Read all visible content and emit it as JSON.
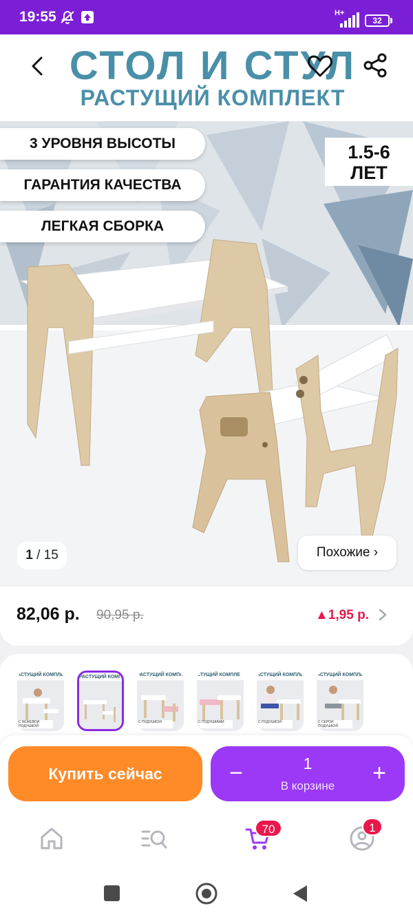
{
  "status_bar": {
    "time": "19:55",
    "network": "H+",
    "battery": "32",
    "icons": [
      "mute-notifications-icon",
      "upload-icon",
      "signal-icon",
      "battery-icon"
    ]
  },
  "product_image": {
    "banner_title": "СТОЛ И СТУЛ",
    "banner_subtitle": "РАСТУЩИЙ КОМПЛЕКТ",
    "features": [
      "3 УРОВНЯ ВЫСОТЫ",
      "ГАРАНТИЯ КАЧЕСТВА",
      "ЛЕГКАЯ СБОРКА"
    ],
    "age_line1": "1.5-6",
    "age_line2": "ЛЕТ",
    "counter_current": "1",
    "counter_total": "/ 15",
    "similar_label": "Похожие ›"
  },
  "nav_icons": [
    "back-arrow-icon",
    "heart-icon",
    "share-icon"
  ],
  "price": {
    "current": "82,06 р.",
    "old": "90,95 р.",
    "delta": "▲1,95 р."
  },
  "thumbnails": [
    {
      "top": "АСТУЩИЙ КОМПЛЕ",
      "caption": "С БЕЖЕВОЙ ПОДУШКОЙ",
      "active": false
    },
    {
      "top": "РАСТУЩИЙ КОМПЛЕКТ",
      "caption": "",
      "active": true
    },
    {
      "top": "РАСТУЩИЙ КОМПЛЕ",
      "caption": "С ПОДУШКОЙ",
      "active": false
    },
    {
      "top": "СТУЩИЙ КОМПЛЕ",
      "caption": "С ПОДУШКАМИ",
      "active": false
    },
    {
      "top": "АСТУЩИЙ КОМПЛЕ",
      "caption": "С ПОДУШКОЙ",
      "active": false
    },
    {
      "top": "АСТУЩИЙ КОМПЛЕ",
      "caption": "С СЕРОЙ ПОДУШКОЙ",
      "active": false
    }
  ],
  "actions": {
    "buy_label": "Купить сейчас",
    "minus": "−",
    "plus": "+",
    "quantity": "1",
    "in_cart_label": "В корзине"
  },
  "tab_bar": {
    "cart_badge": "70",
    "profile_badge": "1"
  },
  "colors": {
    "brand_purple": "#7b1fd6",
    "buy_orange": "#ff8a28",
    "cart_purple": "#9b39f6",
    "price_red": "#e8184c"
  }
}
